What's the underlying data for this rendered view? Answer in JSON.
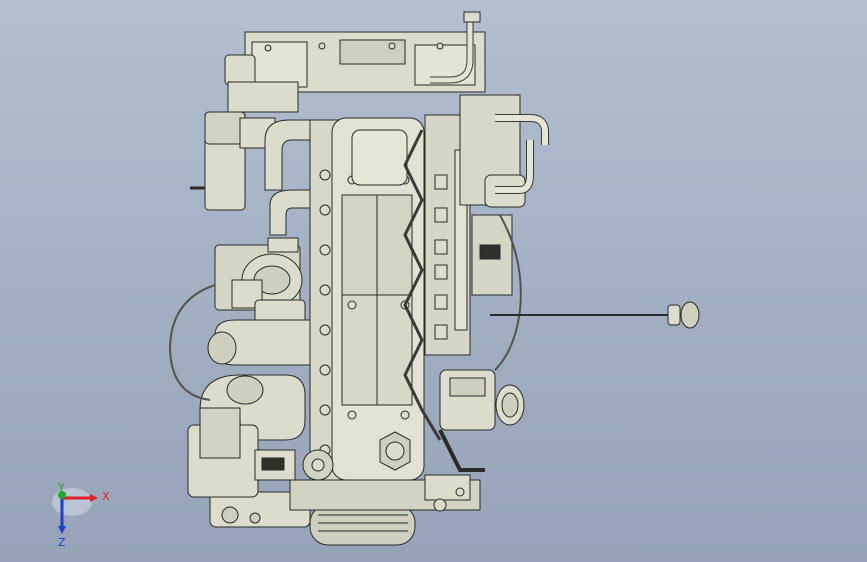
{
  "triad": {
    "x_label": "X",
    "y_label": "Y",
    "z_label": "Z",
    "x_color": "#e0202a",
    "y_color": "#1fa82a",
    "z_color": "#1e3ed0"
  },
  "model": {
    "part_color": "#dcdccc",
    "edge_color": "#2a2a28"
  }
}
